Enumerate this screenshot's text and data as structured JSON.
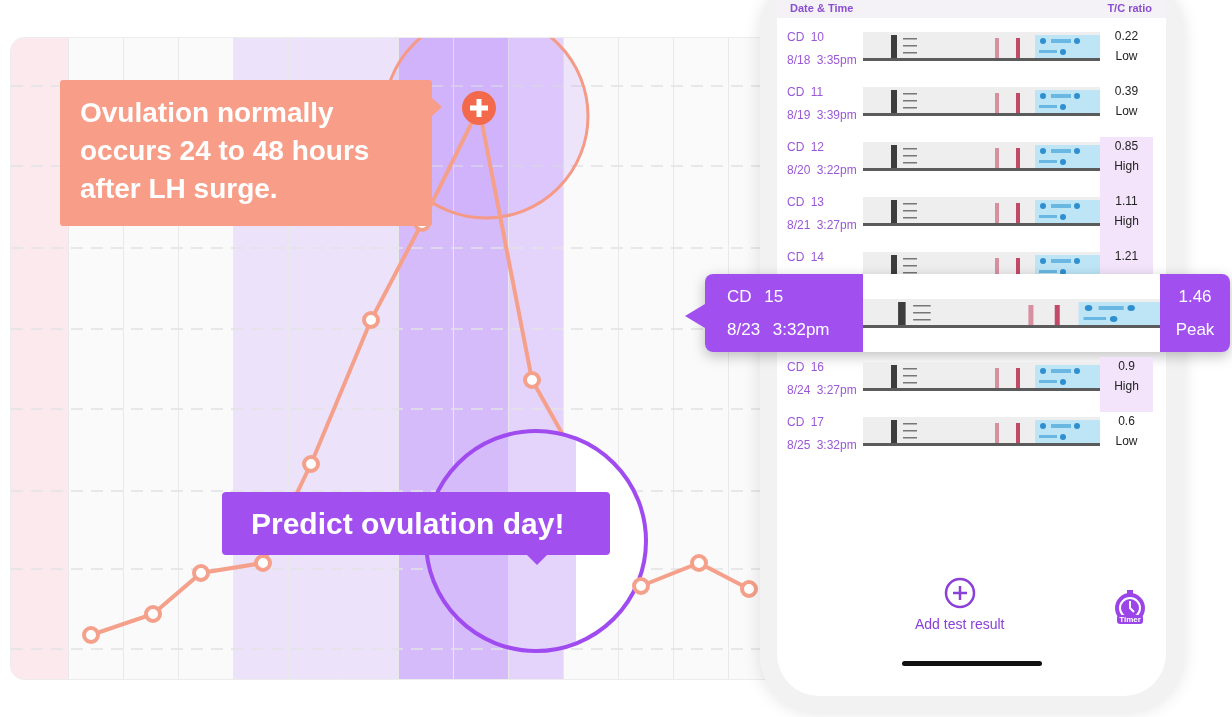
{
  "chart_callouts": {
    "surge_note": "Ovulation normally occurs 24 to 48 hours after LH surge.",
    "predict_note": "Predict ovulation day!"
  },
  "phone": {
    "header": {
      "column_1": "Date & Time",
      "column_2": "T/C ratio"
    },
    "tests": [
      {
        "cycle_day": "CD 10",
        "date": "8/18 3:35pm",
        "ratio": "0.22",
        "level_label": "Low",
        "highlighted": false,
        "selected": false
      },
      {
        "cycle_day": "CD 11",
        "date": "8/19 3:39pm",
        "ratio": "0.39",
        "level_label": "Low",
        "highlighted": false,
        "selected": false
      },
      {
        "cycle_day": "CD 12",
        "date": "8/20 3:22pm",
        "ratio": "0.85",
        "level_label": "High",
        "highlighted": true,
        "selected": false
      },
      {
        "cycle_day": "CD 13",
        "date": "8/21 3:27pm",
        "ratio": "1.11",
        "level_label": "High",
        "highlighted": true,
        "selected": false
      },
      {
        "cycle_day": "CD 14",
        "ratio": "1.21",
        "highlighted": true,
        "selected": false
      },
      {
        "cycle_day": "CD 15",
        "date": "8/23 3:32pm",
        "ratio": "1.46",
        "level_label": "Peak",
        "selected": true
      },
      {
        "cycle_day": "CD 16",
        "date": "8/24 3:27pm",
        "ratio": "0.9",
        "level_label": "High",
        "highlighted": true,
        "selected": false
      },
      {
        "cycle_day": "CD 17",
        "date": "8/25 3:32pm",
        "ratio": "0.6",
        "level_label": "Low",
        "highlighted": false,
        "selected": false
      }
    ],
    "add_button": "Add test result",
    "timer_button": "Timer"
  }
}
